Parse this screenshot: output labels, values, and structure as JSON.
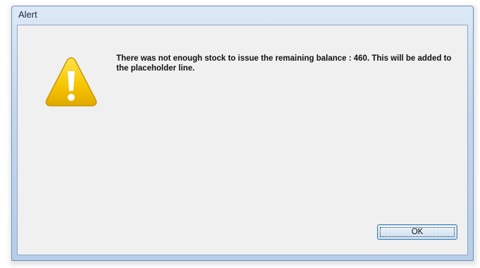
{
  "window": {
    "title": "Alert"
  },
  "alert": {
    "icon": "warning-icon",
    "message": "There was not enough stock to issue the remaining balance : 460. This will be added to the placeholder line.",
    "ok_label": "OK"
  },
  "colors": {
    "warning_fill": "#f5c400",
    "client_bg": "#f0f0f0",
    "frame": "#c4d7ee"
  }
}
